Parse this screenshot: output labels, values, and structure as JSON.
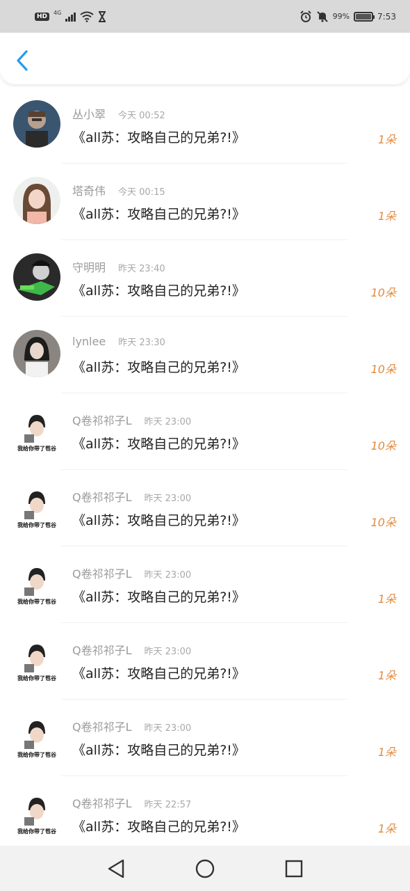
{
  "status_bar": {
    "hd": "HD",
    "network": "4G",
    "battery_percent": "99%",
    "time": "7:53",
    "icons": [
      "hd-icon",
      "signal-icon",
      "wifi-icon",
      "hourglass-icon",
      "alarm-icon",
      "mute-icon",
      "battery-icon"
    ]
  },
  "header": {
    "back_icon": "chevron-left-icon",
    "accent": "#2a9be5"
  },
  "items": [
    {
      "name": "丛小翠",
      "time": "今天 00:52",
      "message": "《all苏：攻略自己的兄弟?!》",
      "count": "1朵"
    },
    {
      "name": "塔奇伟",
      "time": "今天 00:15",
      "message": "《all苏：攻略自己的兄弟?!》",
      "count": "1朵"
    },
    {
      "name": "守明明",
      "time": "昨天 23:40",
      "message": "《all苏：攻略自己的兄弟?!》",
      "count": "10朵"
    },
    {
      "name": "lynlee",
      "time": "昨天 23:30",
      "message": "《all苏：攻略自己的兄弟?!》",
      "count": "10朵"
    },
    {
      "name": "Q卷祁祁子L",
      "time": "昨天 23:00",
      "message": "《all苏：攻略自己的兄弟?!》",
      "count": "10朵"
    },
    {
      "name": "Q卷祁祁子L",
      "time": "昨天 23:00",
      "message": "《all苏：攻略自己的兄弟?!》",
      "count": "10朵"
    },
    {
      "name": "Q卷祁祁子L",
      "time": "昨天 23:00",
      "message": "《all苏：攻略自己的兄弟?!》",
      "count": "1朵"
    },
    {
      "name": "Q卷祁祁子L",
      "time": "昨天 23:00",
      "message": "《all苏：攻略自己的兄弟?!》",
      "count": "1朵"
    },
    {
      "name": "Q卷祁祁子L",
      "time": "昨天 23:00",
      "message": "《all苏：攻略自己的兄弟?!》",
      "count": "1朵"
    },
    {
      "name": "Q卷祁祁子L",
      "time": "昨天 22:57",
      "message": "《all苏：攻略自己的兄弟?!》",
      "count": "1朵"
    }
  ],
  "sticker_caption": "我给你带了苞谷",
  "nav_bar": {
    "icons": [
      "back-triangle-icon",
      "home-circle-icon",
      "recents-square-icon"
    ]
  },
  "colors": {
    "count": "#e38a3c",
    "name": "#9b9b9b",
    "status_bar_bg": "#d9d9d9",
    "nav_bar_bg": "#f2f2f2"
  }
}
